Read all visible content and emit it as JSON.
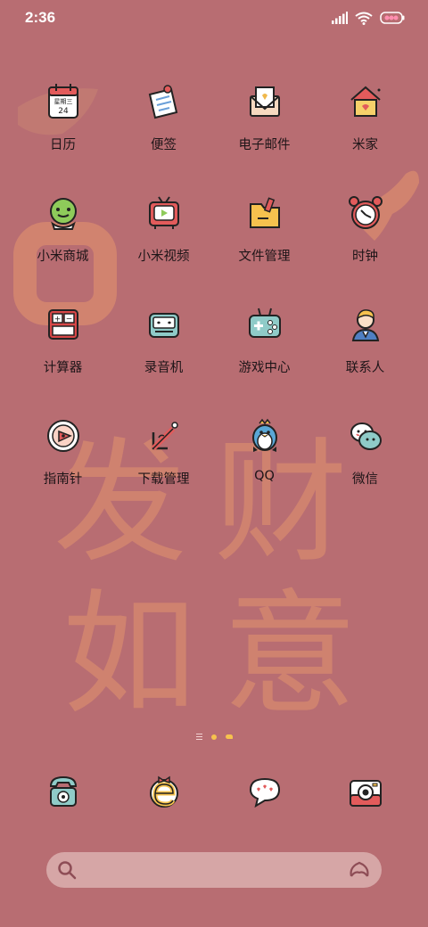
{
  "status_bar": {
    "time": "2:36",
    "icons": [
      "signal-icon",
      "wifi-icon",
      "battery-icon"
    ]
  },
  "wallpaper": {
    "background_color": "#b86d72",
    "overlay_color": "#d98b6f",
    "calligraphy_line1": "发财",
    "calligraphy_line2": "如意"
  },
  "calendar_icon": {
    "weekday": "星期三",
    "day": "24"
  },
  "apps": [
    {
      "label": "日历",
      "icon": "calendar-icon"
    },
    {
      "label": "便签",
      "icon": "notes-icon"
    },
    {
      "label": "电子邮件",
      "icon": "email-icon"
    },
    {
      "label": "米家",
      "icon": "home-icon"
    },
    {
      "label": "小米商城",
      "icon": "mall-icon"
    },
    {
      "label": "小米视频",
      "icon": "video-icon"
    },
    {
      "label": "文件管理",
      "icon": "folder-icon"
    },
    {
      "label": "时钟",
      "icon": "clock-icon"
    },
    {
      "label": "计算器",
      "icon": "calculator-icon"
    },
    {
      "label": "录音机",
      "icon": "recorder-icon"
    },
    {
      "label": "游戏中心",
      "icon": "game-icon"
    },
    {
      "label": "联系人",
      "icon": "contacts-icon"
    },
    {
      "label": "指南针",
      "icon": "compass-icon"
    },
    {
      "label": "下载管理",
      "icon": "download-icon"
    },
    {
      "label": "QQ",
      "icon": "qq-icon"
    },
    {
      "label": "微信",
      "icon": "wechat-icon"
    }
  ],
  "dock": [
    {
      "icon": "phone-icon"
    },
    {
      "icon": "browser-icon"
    },
    {
      "icon": "messages-icon"
    },
    {
      "icon": "camera-icon"
    }
  ],
  "search": {
    "placeholder": "",
    "icons": [
      "search-icon",
      "assistant-icon"
    ]
  },
  "page_indicator": {
    "pages": 3,
    "current": 2
  }
}
